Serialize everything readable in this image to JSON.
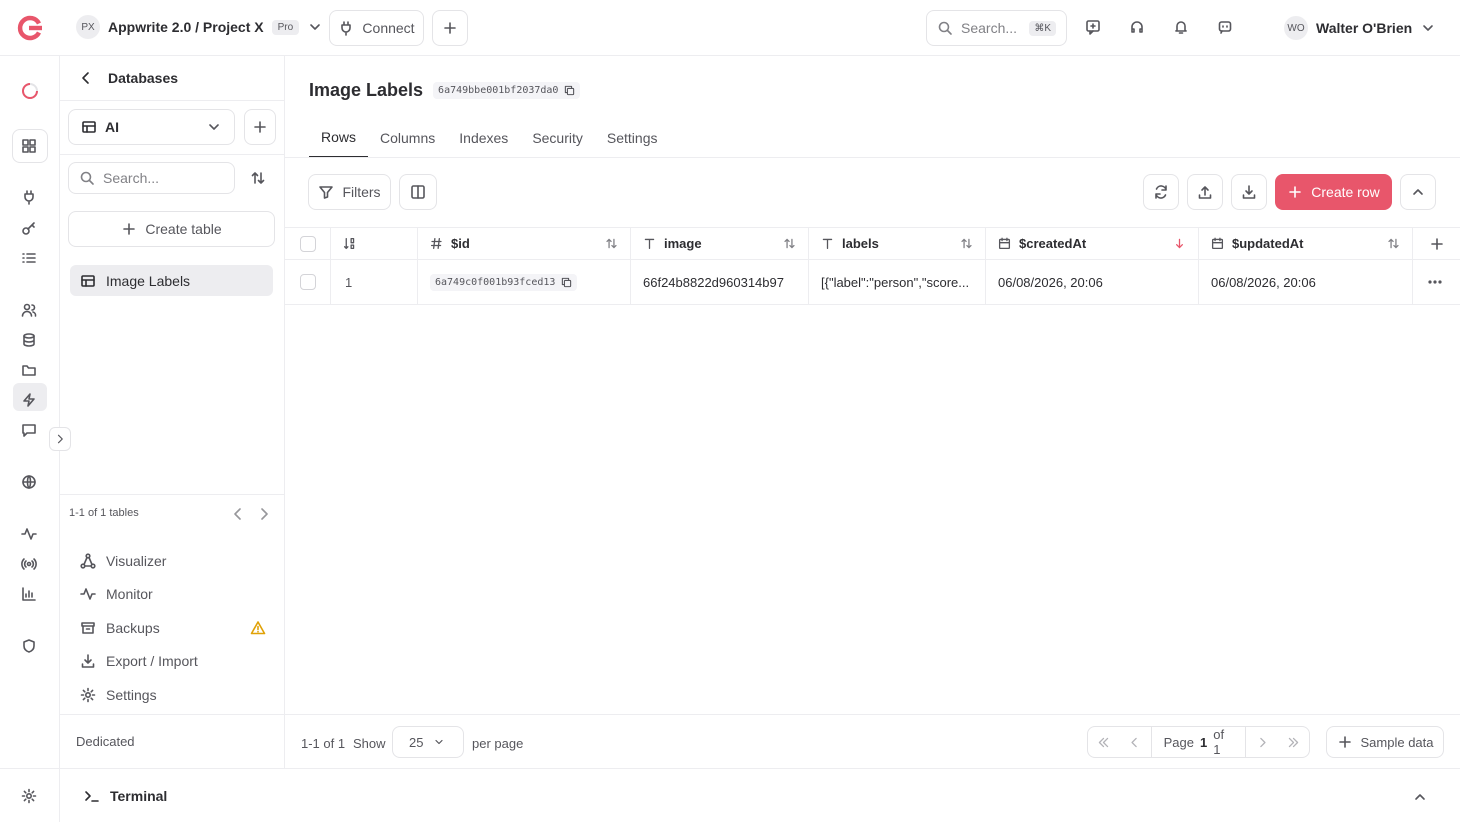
{
  "app": {
    "brand_color": "#e8566b",
    "logo_icon": "appwrite-logo-icon"
  },
  "topbar": {
    "project_initials": "PX",
    "project_name": "Appwrite 2.0 / Project X",
    "plan_badge": "Pro",
    "connect_label": "Connect",
    "search_placeholder": "Search...",
    "search_shortcut": "⌘K",
    "user_initials": "WO",
    "user_name": "Walter O'Brien"
  },
  "sidebar": {
    "back_label": "Databases",
    "database_name": "AI",
    "search_placeholder": "Search...",
    "create_table_label": "Create table",
    "tables": [
      {
        "label": "Image Labels"
      }
    ],
    "tables_count": "1-1 of 1 tables",
    "nav": [
      {
        "label": "Visualizer",
        "icon": "visualizer-icon"
      },
      {
        "label": "Monitor",
        "icon": "activity-icon"
      },
      {
        "label": "Backups",
        "icon": "archive-icon",
        "warning": true
      },
      {
        "label": "Export / Import",
        "icon": "download-icon"
      },
      {
        "label": "Settings",
        "icon": "gear-icon"
      }
    ],
    "footer_label": "Dedicated"
  },
  "main": {
    "title": "Image Labels",
    "table_id": "6a749bbe001bf2037da0",
    "tabs": [
      {
        "label": "Rows",
        "active": true
      },
      {
        "label": "Columns"
      },
      {
        "label": "Indexes"
      },
      {
        "label": "Security"
      },
      {
        "label": "Settings"
      }
    ],
    "toolbar": {
      "filters_label": "Filters",
      "create_row_label": "Create row"
    },
    "columns": [
      {
        "label": "$id",
        "icon": "hash-icon"
      },
      {
        "label": "image",
        "icon": "text-icon"
      },
      {
        "label": "labels",
        "icon": "text-icon"
      },
      {
        "label": "$createdAt",
        "icon": "calendar-icon",
        "sorted": "desc"
      },
      {
        "label": "$updatedAt",
        "icon": "calendar-icon"
      }
    ],
    "rows": [
      {
        "index": "1",
        "id": "6a749c0f001b93fced13",
        "image": "66f24b8822d960314b97",
        "labels": "[{\"label\":\"person\",\"score...",
        "createdAt": "06/08/2026, 20:06",
        "updatedAt": "06/08/2026, 20:06"
      }
    ],
    "footer": {
      "range": "1-1 of 1",
      "show_label": "Show",
      "per_page_value": "25",
      "per_page_label": "per page",
      "page_label": "Page",
      "page_current": "1",
      "page_total": "of 1",
      "sample_data_label": "Sample data"
    }
  },
  "terminal": {
    "label": "Terminal"
  }
}
